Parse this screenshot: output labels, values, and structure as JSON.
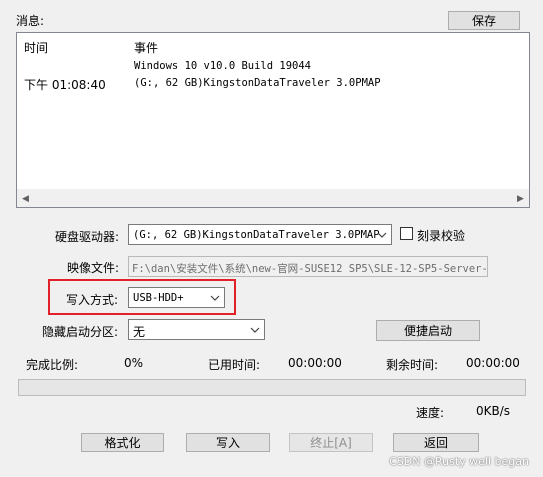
{
  "messages": {
    "label": "消息:",
    "save_button": "保存",
    "col_time": "时间",
    "col_event": "事件",
    "rows": [
      {
        "time": "",
        "event": "Windows 10 v10.0 Build 19044"
      },
      {
        "time": "下午 01:08:40",
        "event": "(G:, 62 GB)KingstonDataTraveler 3.0PMAP"
      }
    ]
  },
  "disk": {
    "label": "硬盘驱动器:",
    "value": "(G:, 62 GB)KingstonDataTraveler 3.0PMAP",
    "verify_label": "刻录校验",
    "verify_checked": false
  },
  "image_file": {
    "label": "映像文件:",
    "value": "F:\\dan\\安装文件\\系统\\new-官网-SUSE12 SP5\\SLE-12-SP5-Server-"
  },
  "write_mode": {
    "label": "写入方式:",
    "value": "USB-HDD+"
  },
  "hidden_partition": {
    "label": "隐藏启动分区:",
    "value": "无",
    "quick_boot_button": "便捷启动"
  },
  "status": {
    "completion_label": "完成比例:",
    "completion_value": "0%",
    "elapsed_label": "已用时间:",
    "elapsed_value": "00:00:00",
    "remaining_label": "剩余时间:",
    "remaining_value": "00:00:00",
    "progress_fraction": 0,
    "speed_label": "速度:",
    "speed_value": "0KB/s"
  },
  "actions": {
    "format": "格式化",
    "write": "写入",
    "abort": "终止[A]",
    "back": "返回"
  },
  "watermark": "CSDN @Rusty well began",
  "colors": {
    "highlight": "#e2202a",
    "progress": "#06b025"
  }
}
